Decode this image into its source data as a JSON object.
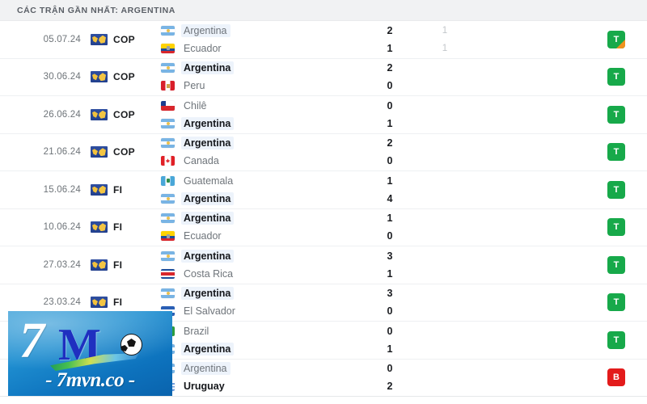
{
  "header": {
    "title": "CÁC TRẬN GẦN NHẤT: ARGENTINA"
  },
  "watermark": {
    "mark_7": "7",
    "mark_m": "M",
    "site": "- 7mvn.co -"
  },
  "colors": {
    "header_bg": "#f1f2f3",
    "win_badge": "#17a94a",
    "loss_badge": "#e31b1b",
    "penalty_corner": "#f0921e",
    "highlight": "#edf3fb"
  },
  "matches": [
    {
      "date": "05.07.24",
      "competition": "COP",
      "competition_icon": "copa-america-icon",
      "home": {
        "name": "Argentina",
        "flag": "fl-ar",
        "bold": false,
        "highlight": true
      },
      "away": {
        "name": "Ecuador",
        "flag": "fl-ec",
        "bold": false,
        "highlight": false
      },
      "score_home": "2",
      "score_away": "1",
      "score2_home": "1",
      "score2_away": "1",
      "result": "T",
      "result_type": "win",
      "penalty": true
    },
    {
      "date": "30.06.24",
      "competition": "COP",
      "competition_icon": "copa-america-icon",
      "home": {
        "name": "Argentina",
        "flag": "fl-ar",
        "bold": true,
        "highlight": true
      },
      "away": {
        "name": "Peru",
        "flag": "fl-pe",
        "bold": false,
        "highlight": false
      },
      "score_home": "2",
      "score_away": "0",
      "score2_home": "",
      "score2_away": "",
      "result": "T",
      "result_type": "win",
      "penalty": false
    },
    {
      "date": "26.06.24",
      "competition": "COP",
      "competition_icon": "copa-america-icon",
      "home": {
        "name": "Chilê",
        "flag": "fl-cl",
        "bold": false,
        "highlight": false
      },
      "away": {
        "name": "Argentina",
        "flag": "fl-ar",
        "bold": true,
        "highlight": true
      },
      "score_home": "0",
      "score_away": "1",
      "score2_home": "",
      "score2_away": "",
      "result": "T",
      "result_type": "win",
      "penalty": false
    },
    {
      "date": "21.06.24",
      "competition": "COP",
      "competition_icon": "copa-america-icon",
      "home": {
        "name": "Argentina",
        "flag": "fl-ar",
        "bold": true,
        "highlight": true
      },
      "away": {
        "name": "Canada",
        "flag": "fl-ca",
        "bold": false,
        "highlight": false
      },
      "score_home": "2",
      "score_away": "0",
      "score2_home": "",
      "score2_away": "",
      "result": "T",
      "result_type": "win",
      "penalty": false
    },
    {
      "date": "15.06.24",
      "competition": "FI",
      "competition_icon": "friendly-icon",
      "home": {
        "name": "Guatemala",
        "flag": "fl-gt",
        "bold": false,
        "highlight": false
      },
      "away": {
        "name": "Argentina",
        "flag": "fl-ar",
        "bold": true,
        "highlight": true
      },
      "score_home": "1",
      "score_away": "4",
      "score2_home": "",
      "score2_away": "",
      "result": "T",
      "result_type": "win",
      "penalty": false
    },
    {
      "date": "10.06.24",
      "competition": "FI",
      "competition_icon": "friendly-icon",
      "home": {
        "name": "Argentina",
        "flag": "fl-ar",
        "bold": true,
        "highlight": true
      },
      "away": {
        "name": "Ecuador",
        "flag": "fl-ec",
        "bold": false,
        "highlight": false
      },
      "score_home": "1",
      "score_away": "0",
      "score2_home": "",
      "score2_away": "",
      "result": "T",
      "result_type": "win",
      "penalty": false
    },
    {
      "date": "27.03.24",
      "competition": "FI",
      "competition_icon": "friendly-icon",
      "home": {
        "name": "Argentina",
        "flag": "fl-ar",
        "bold": true,
        "highlight": true
      },
      "away": {
        "name": "Costa Rica",
        "flag": "fl-cr",
        "bold": false,
        "highlight": false
      },
      "score_home": "3",
      "score_away": "1",
      "score2_home": "",
      "score2_away": "",
      "result": "T",
      "result_type": "win",
      "penalty": false
    },
    {
      "date": "23.03.24",
      "competition": "FI",
      "competition_icon": "friendly-icon",
      "home": {
        "name": "Argentina",
        "flag": "fl-ar",
        "bold": true,
        "highlight": true
      },
      "away": {
        "name": "El Salvador",
        "flag": "fl-sv",
        "bold": false,
        "highlight": false
      },
      "score_home": "3",
      "score_away": "0",
      "score2_home": "",
      "score2_away": "",
      "result": "T",
      "result_type": "win",
      "penalty": false
    },
    {
      "date": "",
      "competition": "",
      "competition_icon": "friendly-icon",
      "home": {
        "name": "Brazil",
        "flag": "fl-br",
        "bold": false,
        "highlight": false
      },
      "away": {
        "name": "Argentina",
        "flag": "fl-ar",
        "bold": true,
        "highlight": true
      },
      "score_home": "0",
      "score_away": "1",
      "score2_home": "",
      "score2_away": "",
      "result": "T",
      "result_type": "win",
      "penalty": false
    },
    {
      "date": "",
      "competition": "",
      "competition_icon": "friendly-icon",
      "home": {
        "name": "Argentina",
        "flag": "fl-ar",
        "bold": false,
        "highlight": true
      },
      "away": {
        "name": "Uruguay",
        "flag": "fl-uy",
        "bold": true,
        "highlight": false
      },
      "score_home": "0",
      "score_away": "2",
      "score2_home": "",
      "score2_away": "",
      "result": "B",
      "result_type": "loss",
      "penalty": false
    }
  ]
}
